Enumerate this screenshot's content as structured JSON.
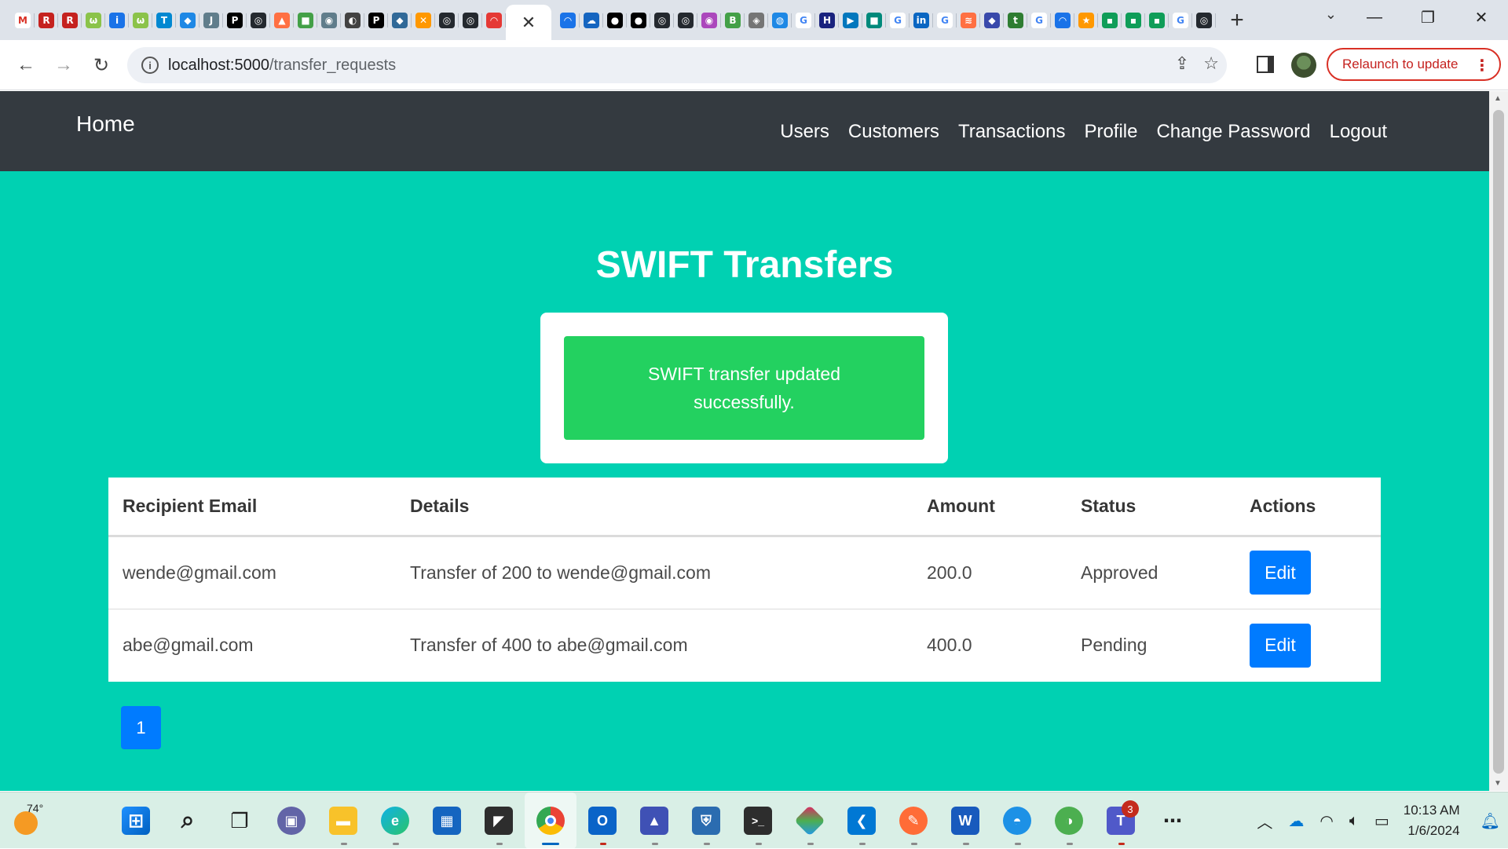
{
  "browser": {
    "tab_close": "✕",
    "new_tab": "+",
    "url_host": "localhost:5000",
    "url_path": "/transfer_requests",
    "relaunch_label": "Relaunch to update",
    "window_controls": {
      "minimize": "—",
      "maximize": "❐",
      "close": "✕"
    }
  },
  "app": {
    "brand": "Home",
    "nav": [
      "Users",
      "Customers",
      "Transactions",
      "Profile",
      "Change Password",
      "Logout"
    ],
    "title": "SWIFT Transfers",
    "alert": "SWIFT transfer updated successfully.",
    "table": {
      "headers": [
        "Recipient Email",
        "Details",
        "Amount",
        "Status",
        "Actions"
      ],
      "rows": [
        {
          "email": "wende@gmail.com",
          "details": "Transfer of 200 to wende@gmail.com",
          "amount": "200.0",
          "status": "Approved",
          "action": "Edit"
        },
        {
          "email": "abe@gmail.com",
          "details": "Transfer of 400 to abe@gmail.com",
          "amount": "400.0",
          "status": "Pending",
          "action": "Edit"
        }
      ]
    },
    "pagination": {
      "current": "1"
    }
  },
  "taskbar": {
    "weather_temp": "74°",
    "teams_badge": "3",
    "time": "10:13 AM",
    "date": "1/6/2024"
  },
  "colors": {
    "page_bg": "#00d1b2",
    "navbar": "#343a40",
    "alert_success": "#23d160",
    "primary_button": "#007bff"
  }
}
